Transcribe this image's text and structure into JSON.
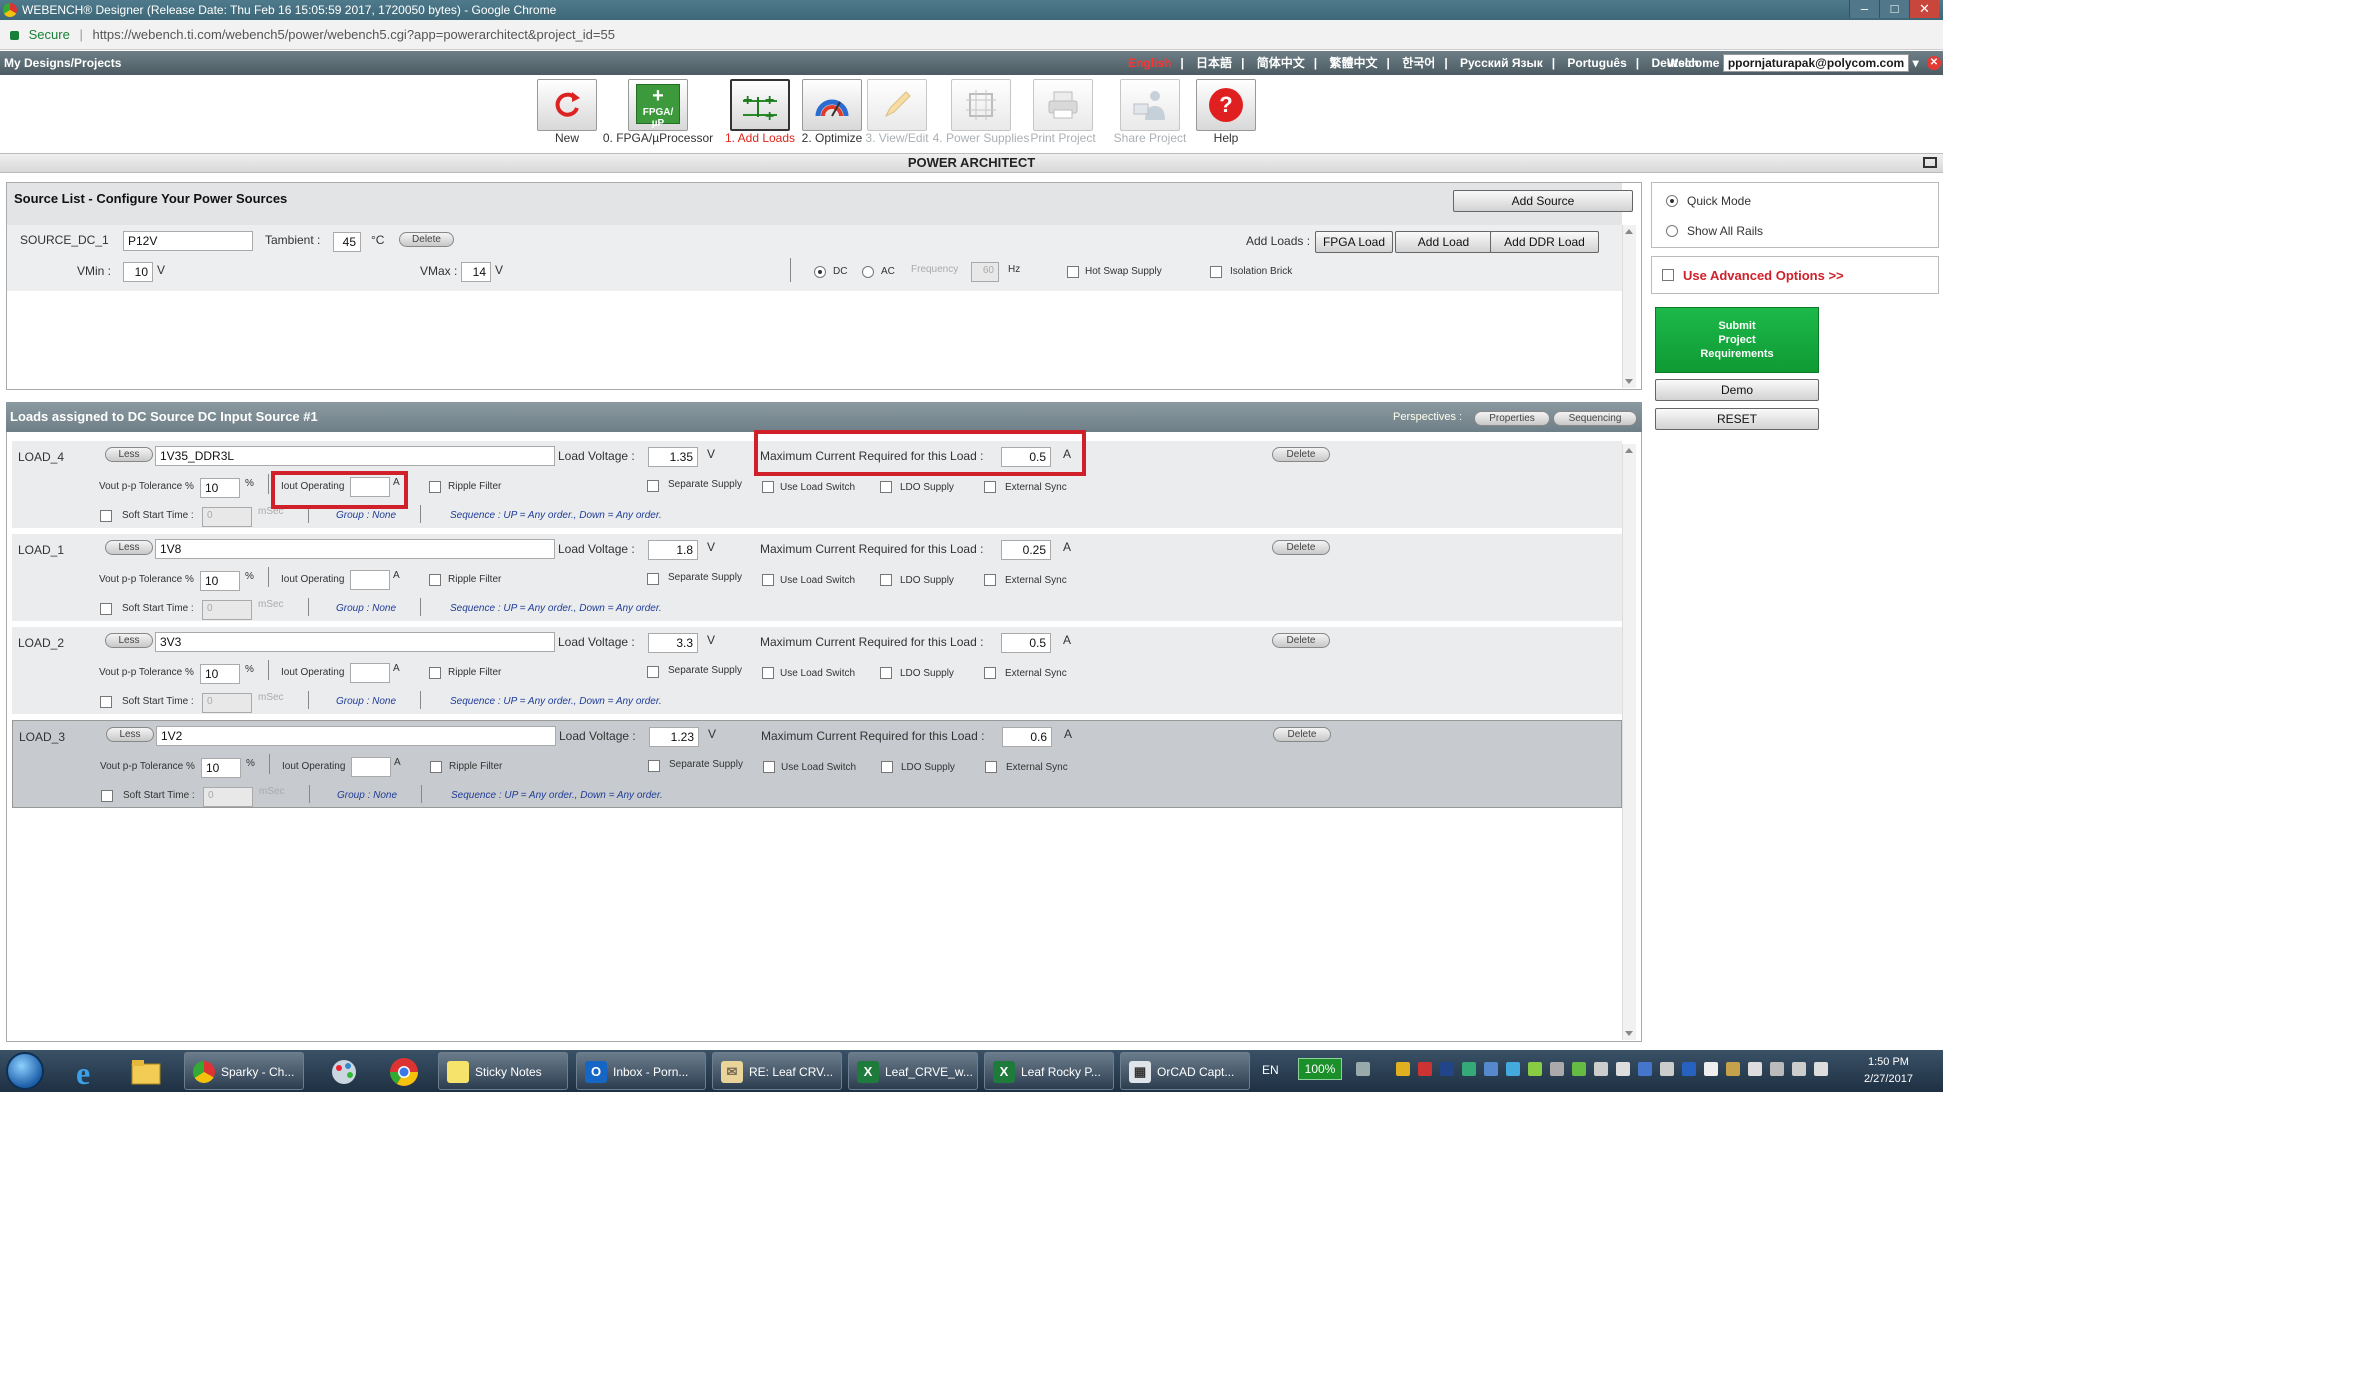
{
  "browser": {
    "title": "WEBENCH® Designer (Release Date: Thu Feb 16 15:05:59 2017, 1720050 bytes) - Google Chrome",
    "secure_label": "Secure",
    "url": "https://webench.ti.com/webench5/power/webench5.cgi?app=powerarchitect&project_id=55"
  },
  "navbar": {
    "my_designs": "My Designs/Projects",
    "languages": [
      "English",
      "日本語",
      "简体中文",
      "繁體中文",
      "한국어",
      "Русский Язык",
      "Português",
      "Deutsch"
    ],
    "separator": "|",
    "welcome": "Welcome",
    "user": "ppornjaturapak@polycom.com"
  },
  "toolbar": [
    {
      "label": "New",
      "icon": "refresh-icon",
      "state": "normal"
    },
    {
      "label": "0. FPGA/µProcessor",
      "icon": "fpga-icon",
      "icon_text": "FPGA/µP",
      "state": "normal"
    },
    {
      "label": "1. Add Loads",
      "icon": "add-loads-icon",
      "state": "active"
    },
    {
      "label": "2. Optimize",
      "icon": "gauge-icon",
      "state": "normal"
    },
    {
      "label": "3. View/Edit",
      "icon": "pencil-icon",
      "state": "disabled"
    },
    {
      "label": "4. Power Supplies",
      "icon": "chip-icon",
      "state": "disabled"
    },
    {
      "label": "Print Project",
      "icon": "printer-icon",
      "state": "disabled"
    },
    {
      "label": "Share Project",
      "icon": "share-icon",
      "state": "disabled"
    },
    {
      "label": "Help",
      "icon": "help-icon",
      "icon_text": "?",
      "state": "normal"
    }
  ],
  "power_architect_title": "POWER ARCHITECT",
  "source": {
    "header": "Source List - Configure Your Power Sources",
    "add_source": "Add Source",
    "name": "SOURCE_DC_1",
    "value": "P12V",
    "tambient_label": "Tambient :",
    "tambient": "45",
    "tambient_unit": "°C",
    "delete": "Delete",
    "add_loads_label": "Add Loads :",
    "fpga_load": "FPGA Load",
    "add_load": "Add Load",
    "ddr_load": "Add DDR Load",
    "vmin_label": "VMin :",
    "vmin": "10",
    "vmax_label": "VMax :",
    "vmax": "14",
    "v_unit": "V",
    "dc": "DC",
    "ac": "AC",
    "frequency": "Frequency",
    "freq_value": "60",
    "hz": "Hz",
    "hot_swap": "Hot Swap Supply",
    "isolation": "Isolation Brick"
  },
  "loads_header": "Loads assigned to DC Source DC Input Source #1",
  "perspectives": {
    "label": "Perspectives :",
    "properties": "Properties",
    "sequencing": "Sequencing"
  },
  "load_labels": {
    "less": "Less",
    "load_voltage": "Load Voltage :",
    "max_current": "Maximum Current Required for this Load :",
    "delete": "Delete",
    "tolerance": "Vout p-p Tolerance %",
    "percent": "%",
    "iout": "Iout Operating",
    "a_unit": "A",
    "v_unit": "V",
    "ripple": "Ripple Filter",
    "separate": "Separate Supply",
    "load_switch": "Use Load Switch",
    "ldo": "LDO Supply",
    "ext_sync": "External Sync",
    "soft_start": "Soft Start Time :",
    "msec": "mSec",
    "soft_start_value": "0",
    "group": "Group : None",
    "sequence": "Sequence : UP = Any order., Down = Any order."
  },
  "loads": [
    {
      "id": "LOAD_4",
      "name": "1V35_DDR3L",
      "voltage": "1.35",
      "current": "0.5",
      "tolerance": "10"
    },
    {
      "id": "LOAD_1",
      "name": "1V8",
      "voltage": "1.8",
      "current": "0.25",
      "tolerance": "10"
    },
    {
      "id": "LOAD_2",
      "name": "3V3",
      "voltage": "3.3",
      "current": "0.5",
      "tolerance": "10"
    },
    {
      "id": "LOAD_3",
      "name": "1V2",
      "voltage": "1.23",
      "current": "0.6",
      "tolerance": "10"
    }
  ],
  "side": {
    "quick_mode": "Quick Mode",
    "show_all": "Show All Rails",
    "advanced": "Use Advanced Options >>",
    "submit": [
      "Submit",
      "Project",
      "Requirements"
    ],
    "demo": "Demo",
    "reset": "RESET"
  },
  "taskbar": {
    "items": [
      "Sparky - Ch...",
      "Sticky Notes",
      "Inbox - Porn...",
      "RE: Leaf CRV...",
      "Leaf_CRVE_w...",
      "Leaf Rocky P...",
      "OrCAD Capt..."
    ],
    "lang": "EN",
    "battery": "100%",
    "time": "1:50 PM",
    "date": "2/27/2017"
  }
}
